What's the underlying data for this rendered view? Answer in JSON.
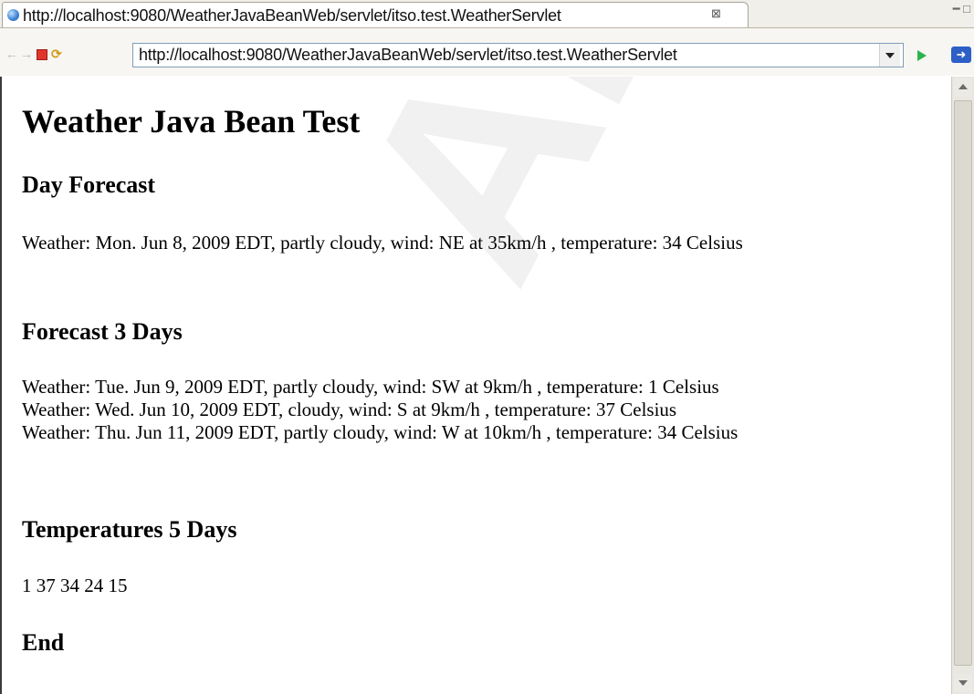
{
  "tab": {
    "title": "http://localhost:9080/WeatherJavaBeanWeb/servlet/itso.test.WeatherServlet",
    "close_glyph": "⊠"
  },
  "toolbar": {
    "back_icon": "back-arrow-icon",
    "forward_icon": "forward-arrow-icon",
    "stop_icon": "stop-icon",
    "refresh_icon": "refresh-icon",
    "url": "http://localhost:9080/WeatherJavaBeanWeb/servlet/itso.test.WeatherServlet",
    "go_icon": "go-icon"
  },
  "page": {
    "title": "Weather Java Bean Test",
    "day_forecast": {
      "heading": "Day Forecast",
      "text": "Weather: Mon. Jun 8, 2009 EDT, partly cloudy, wind: NE at 35km/h , temperature: 34 Celsius"
    },
    "forecast_3_days": {
      "heading": "Forecast 3 Days",
      "lines": [
        "Weather: Tue. Jun 9, 2009 EDT, partly cloudy, wind: SW at 9km/h , temperature: 1 Celsius",
        "Weather: Wed. Jun 10, 2009 EDT, cloudy, wind: S at 9km/h , temperature: 37 Celsius",
        "Weather: Thu. Jun 11, 2009 EDT, partly cloudy, wind: W at 10km/h , temperature: 34 Celsius"
      ]
    },
    "temperatures_5_days": {
      "heading": "Temperatures 5 Days",
      "values": "1 37 34 24 15"
    },
    "end": "End"
  },
  "colors": {
    "url_border": "#7f9db9",
    "stop": "#e0362c",
    "go": "#2bb34a"
  }
}
